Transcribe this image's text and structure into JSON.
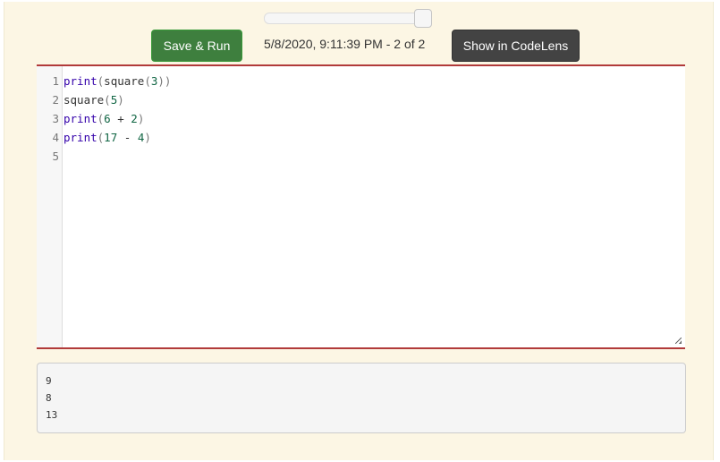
{
  "toolbar": {
    "save_run": "Save & Run",
    "show_codelens": "Show in CodeLens",
    "timestamp": "5/8/2020, 9:11:39 PM - 2 of 2",
    "history_position": "2 of 2"
  },
  "editor": {
    "line_numbers": [
      "1",
      "2",
      "3",
      "4",
      "5"
    ],
    "lines": [
      [
        {
          "t": "print",
          "c": "kw"
        },
        {
          "t": "(",
          "c": "p"
        },
        {
          "t": "square",
          "c": ""
        },
        {
          "t": "(",
          "c": "p"
        },
        {
          "t": "3",
          "c": "num"
        },
        {
          "t": "))",
          "c": "p"
        }
      ],
      [
        {
          "t": "square",
          "c": ""
        },
        {
          "t": "(",
          "c": "p"
        },
        {
          "t": "5",
          "c": "num"
        },
        {
          "t": ")",
          "c": "p"
        }
      ],
      [
        {
          "t": "print",
          "c": "kw"
        },
        {
          "t": "(",
          "c": "p"
        },
        {
          "t": "6",
          "c": "num"
        },
        {
          "t": " + ",
          "c": ""
        },
        {
          "t": "2",
          "c": "num"
        },
        {
          "t": ")",
          "c": "p"
        }
      ],
      [
        {
          "t": "print",
          "c": "kw"
        },
        {
          "t": "(",
          "c": "p"
        },
        {
          "t": "17",
          "c": "num"
        },
        {
          "t": " - ",
          "c": ""
        },
        {
          "t": "4",
          "c": "num"
        },
        {
          "t": ")",
          "c": "p"
        }
      ],
      []
    ]
  },
  "output": [
    "9",
    "8",
    "13"
  ]
}
